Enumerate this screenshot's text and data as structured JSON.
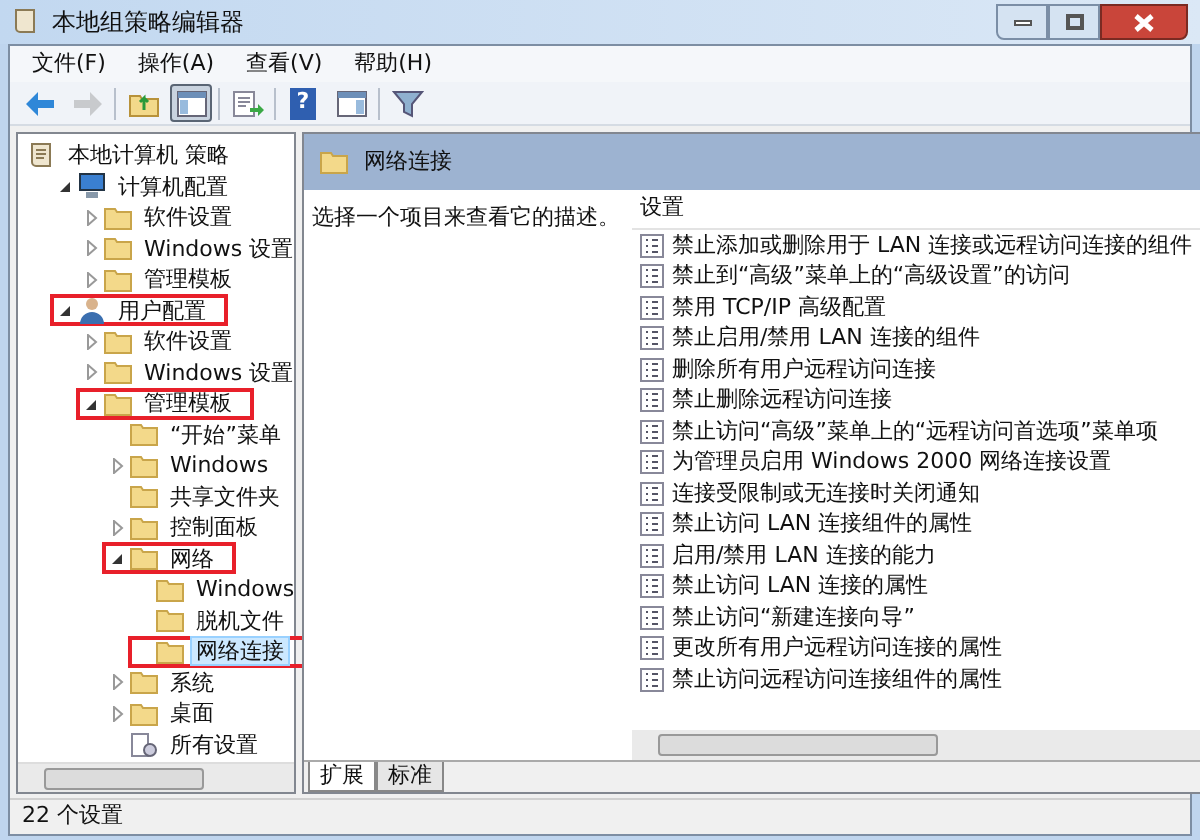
{
  "window": {
    "title": "本地组策略编辑器"
  },
  "menu": [
    "文件(F)",
    "操作(A)",
    "查看(V)",
    "帮助(H)"
  ],
  "toolbar": [
    {
      "kind": "back",
      "disabled": false,
      "pressed": false
    },
    {
      "kind": "forward",
      "disabled": true,
      "pressed": false
    },
    {
      "kind": "separator"
    },
    {
      "kind": "up",
      "disabled": false,
      "pressed": false
    },
    {
      "kind": "tree",
      "disabled": false,
      "pressed": true
    },
    {
      "kind": "separator"
    },
    {
      "kind": "export",
      "disabled": false,
      "pressed": false
    },
    {
      "kind": "separator"
    },
    {
      "kind": "help",
      "label": "?",
      "disabled": false,
      "pressed": false
    },
    {
      "kind": "pane",
      "disabled": false,
      "pressed": false
    },
    {
      "kind": "separator"
    },
    {
      "kind": "filter",
      "disabled": false,
      "pressed": false
    }
  ],
  "tree": [
    {
      "label": "本地计算机 策略",
      "kind": "root",
      "expanded": true,
      "selected": false,
      "highlighted": false,
      "children": [
        {
          "label": "计算机配置",
          "kind": "computer",
          "expanded": true,
          "selected": false,
          "highlighted": false,
          "children": [
            {
              "label": "软件设置",
              "kind": "folder",
              "expanded": false,
              "selected": false,
              "highlighted": false
            },
            {
              "label": "Windows 设置",
              "kind": "folder",
              "expanded": false,
              "selected": false,
              "highlighted": false
            },
            {
              "label": "管理模板",
              "kind": "folder",
              "expanded": false,
              "selected": false,
              "highlighted": false
            }
          ]
        },
        {
          "label": "用户配置",
          "kind": "user",
          "expanded": true,
          "selected": false,
          "highlighted": true,
          "children": [
            {
              "label": "软件设置",
              "kind": "folder",
              "expanded": false,
              "selected": false,
              "highlighted": false
            },
            {
              "label": "Windows 设置",
              "kind": "folder",
              "expanded": false,
              "selected": false,
              "highlighted": false
            },
            {
              "label": "管理模板",
              "kind": "folder",
              "expanded": true,
              "selected": false,
              "highlighted": true,
              "children": [
                {
                  "label": "“开始”菜单",
                  "kind": "leaf",
                  "expanded": false,
                  "selected": false,
                  "highlighted": false
                },
                {
                  "label": "Windows",
                  "kind": "folder",
                  "expanded": false,
                  "selected": false,
                  "highlighted": false
                },
                {
                  "label": "共享文件夹",
                  "kind": "leaf",
                  "expanded": false,
                  "selected": false,
                  "highlighted": false
                },
                {
                  "label": "控制面板",
                  "kind": "folder",
                  "expanded": false,
                  "selected": false,
                  "highlighted": false
                },
                {
                  "label": "网络",
                  "kind": "folder",
                  "expanded": true,
                  "selected": false,
                  "highlighted": true,
                  "children": [
                    {
                      "label": "Windows",
                      "kind": "leaf",
                      "expanded": false,
                      "selected": false,
                      "highlighted": false
                    },
                    {
                      "label": "脱机文件",
                      "kind": "leaf",
                      "expanded": false,
                      "selected": false,
                      "highlighted": false
                    },
                    {
                      "label": "网络连接",
                      "kind": "leaf",
                      "expanded": false,
                      "selected": true,
                      "highlighted": true
                    }
                  ]
                },
                {
                  "label": "系统",
                  "kind": "folder",
                  "expanded": false,
                  "selected": false,
                  "highlighted": false
                },
                {
                  "label": "桌面",
                  "kind": "folder",
                  "expanded": false,
                  "selected": false,
                  "highlighted": false
                },
                {
                  "label": "所有设置",
                  "kind": "settings",
                  "expanded": false,
                  "selected": false,
                  "highlighted": false
                }
              ]
            }
          ]
        }
      ]
    }
  ],
  "detail": {
    "title": "网络连接",
    "description": "选择一个项目来查看它的描述。",
    "column": "设置",
    "settings": [
      "禁止添加或删除用于 LAN 连接或远程访问连接的组件",
      "禁止到“高级”菜单上的“高级设置”的访问",
      "禁用 TCP/IP 高级配置",
      "禁止启用/禁用 LAN 连接的组件",
      "删除所有用户远程访问连接",
      "禁止删除远程访问连接",
      "禁止访问“高级”菜单上的“远程访问首选项”菜单项",
      "为管理员启用 Windows 2000 网络连接设置",
      "连接受限制或无连接时关闭通知",
      "禁止访问 LAN 连接组件的属性",
      "启用/禁用 LAN 连接的能力",
      "禁止访问 LAN 连接的属性",
      "禁止访问“新建连接向导”",
      "更改所有用户远程访问连接的属性",
      "禁止访问远程访问连接组件的属性"
    ]
  },
  "tabs": [
    {
      "label": "扩展",
      "selected": true
    },
    {
      "label": "标准",
      "selected": false
    }
  ],
  "status_bar": "22 个设置"
}
